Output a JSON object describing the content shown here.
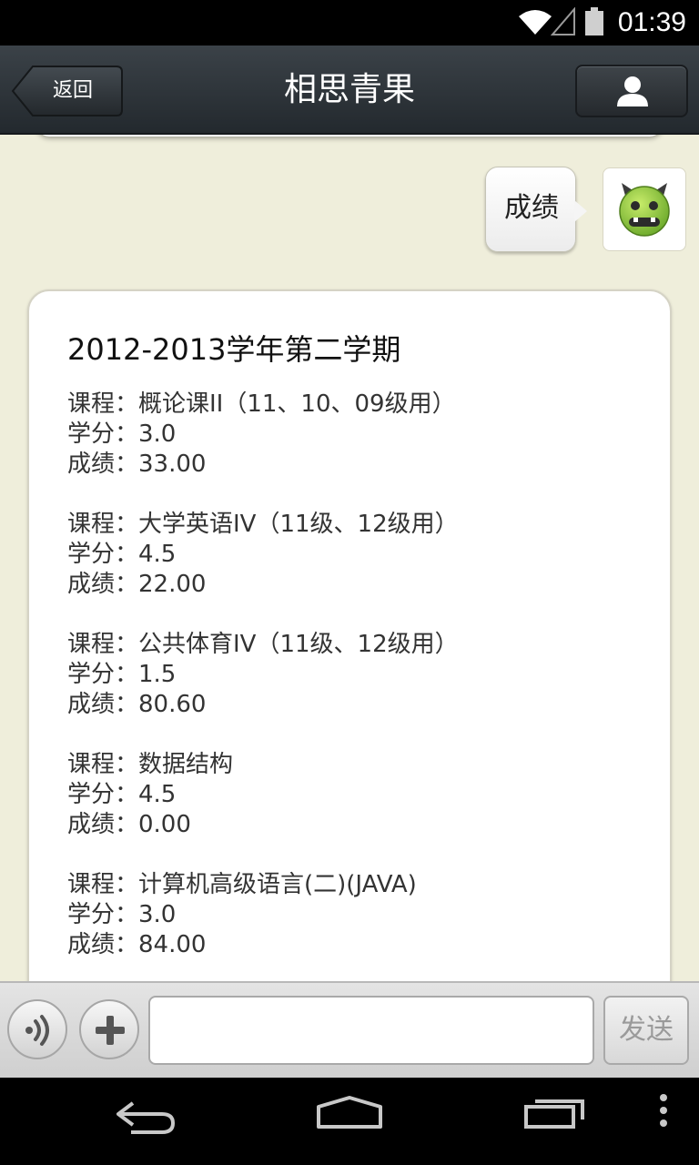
{
  "status_bar": {
    "time": "01:39",
    "icons": [
      "wifi-icon",
      "signal-icon",
      "battery-icon"
    ]
  },
  "header": {
    "back_label": "返回",
    "title": "相思青果",
    "profile_icon": "person-icon"
  },
  "chat": {
    "sent_message": "成绩",
    "avatar_icon": "green-monster-avatar",
    "reply": {
      "term_title": "2012-2013学年第二学期",
      "courses": [
        {
          "course": "课程：概论课II（11、10、09级用）",
          "credits": "学分：3.0",
          "grade": "成绩：33.00"
        },
        {
          "course": "课程：大学英语IV（11级、12级用）",
          "credits": "学分：4.5",
          "grade": "成绩：22.00"
        },
        {
          "course": "课程：公共体育IV（11级、12级用）",
          "credits": "学分：1.5",
          "grade": "成绩：80.60"
        },
        {
          "course": "课程：数据结构",
          "credits": "学分：4.5",
          "grade": "成绩：0.00"
        },
        {
          "course": "课程：计算机高级语言(二)(JAVA)",
          "credits": "学分：3.0",
          "grade": "成绩：84.00"
        }
      ]
    }
  },
  "input_bar": {
    "voice_icon": "voice-icon",
    "plus_icon": "plus-icon",
    "input_value": "",
    "send_label": "发送"
  },
  "nav_bar": {
    "icons": [
      "back-icon",
      "home-icon",
      "recent-apps-icon",
      "menu-icon"
    ]
  },
  "colors": {
    "title_bar": "#2f353a",
    "chat_background": "#efeedb",
    "card": "#ffffff",
    "avatar_green": "#8cc63f"
  }
}
